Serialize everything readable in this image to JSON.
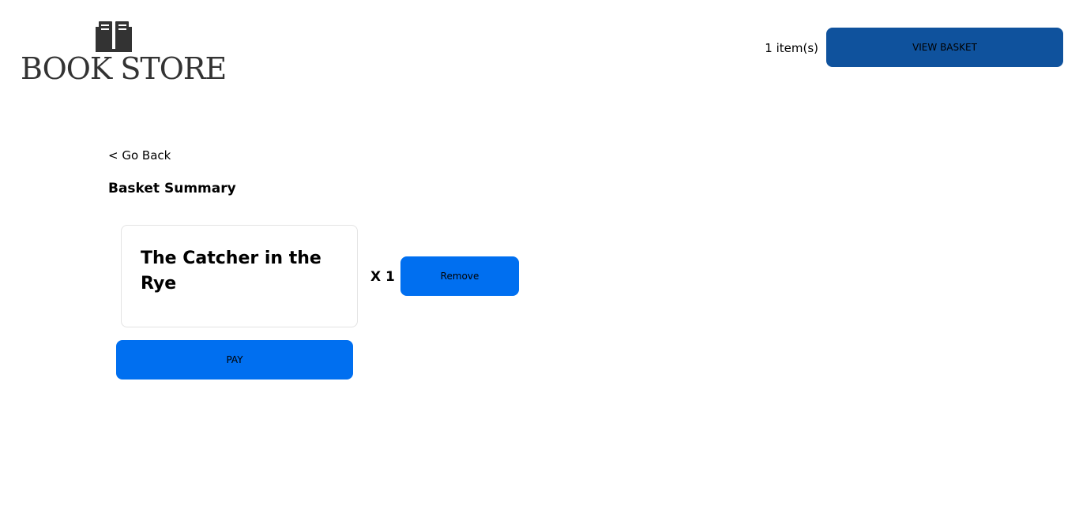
{
  "header": {
    "logo": {
      "icon": "open-book-icon",
      "text": "BOOK STORE"
    },
    "basket_count": "1 item(s)",
    "view_basket_label": "VIEW BASKET"
  },
  "navigation": {
    "go_back_label": "< Go Back"
  },
  "basket": {
    "title": "Basket Summary",
    "items": [
      {
        "title": "The Catcher in the Rye",
        "quantity": "X 1",
        "remove_label": "Remove"
      }
    ],
    "pay_label": "PAY"
  },
  "colors": {
    "view_basket_button": "#0f529d",
    "action_button": "#006ff0",
    "logo_text": "#333333"
  }
}
